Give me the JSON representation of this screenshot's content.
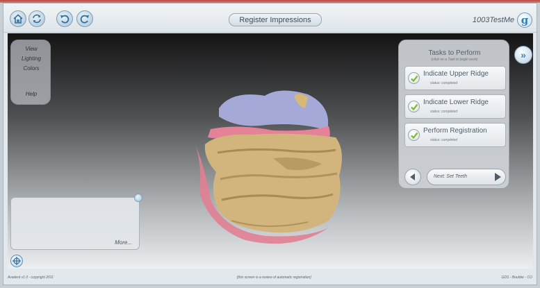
{
  "header": {
    "title": "Register Impressions",
    "user": "1003TestMe",
    "logo_letter": "g"
  },
  "toolbar_buttons": [
    {
      "name": "home-button",
      "icon": "home-icon"
    },
    {
      "name": "sync-button",
      "icon": "sync-icon"
    },
    {
      "name": "undo-button",
      "icon": "undo-icon"
    },
    {
      "name": "redo-button",
      "icon": "redo-icon"
    }
  ],
  "view_menu": {
    "items": [
      "View",
      "Lighting",
      "Colors",
      "Help"
    ]
  },
  "tasks": {
    "title": "Tasks to Perform",
    "subtitle": "(click on a Task to begin work)",
    "toggle_glyph": "»",
    "items": [
      {
        "label": "Indicate Upper Ridge",
        "status": "status: completed"
      },
      {
        "label": "Indicate Lower Ridge",
        "status": "status: completed"
      },
      {
        "label": "Perform Registration",
        "status": "status: completed"
      }
    ],
    "next_label": "Next: Set Teeth"
  },
  "info_panel": {
    "more_label": "More..."
  },
  "footer": {
    "left": "Avadent v1.0 - copyright 2011",
    "center": "[this screen is a review of automatic registration]",
    "right": "GDS - Boulder - CO"
  },
  "colors": {
    "accent": "#3b86bf",
    "check_green": "#7ab82a",
    "model_gum": "#e58298",
    "model_tray": "#d2b57c",
    "model_upper": "#a4a9d6"
  }
}
